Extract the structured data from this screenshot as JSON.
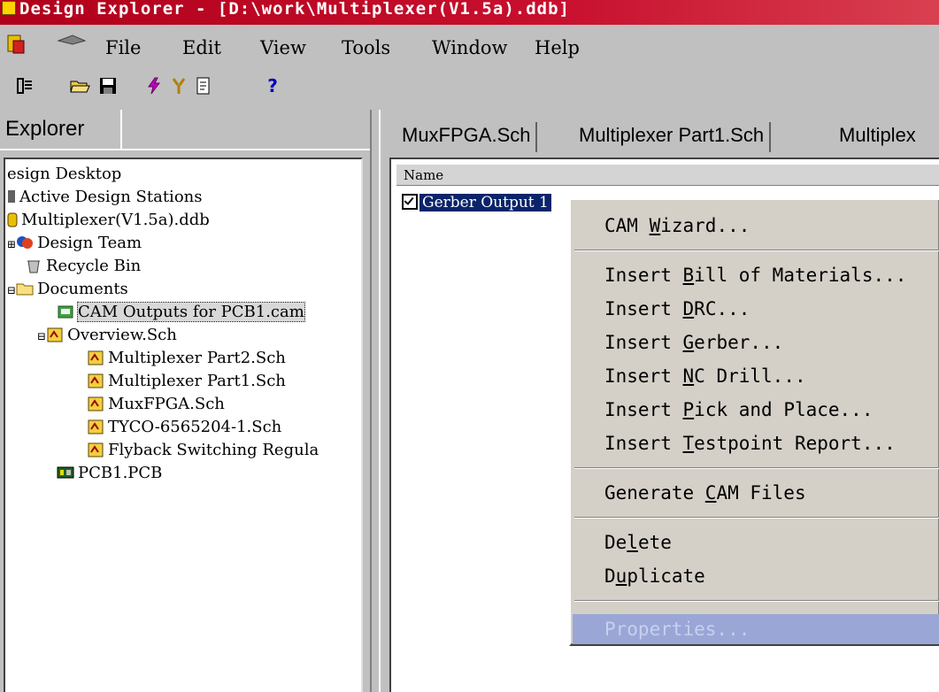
{
  "window": {
    "title": "Design Explorer - [D:\\work\\Multiplexer(V1.5a).ddb]"
  },
  "menu": [
    "File",
    "Edit",
    "View",
    "Tools",
    "Window",
    "Help"
  ],
  "toolbar": {
    "icons": [
      "explorer-toggle-icon",
      "open-folder-icon",
      "save-icon",
      "lightning-icon",
      "tool-icon",
      "document-icon",
      "help-icon"
    ],
    "help_glyph": "?"
  },
  "explorer": {
    "tab_label": "Explorer",
    "tree": [
      {
        "label": "esign Desktop"
      },
      {
        "label": "Active Design Stations"
      },
      {
        "label": "Multiplexer(V1.5a).ddb"
      },
      {
        "label": "Design Team"
      },
      {
        "label": "Recycle Bin"
      },
      {
        "label": "Documents"
      },
      {
        "label": "CAM Outputs for PCB1.cam",
        "selected": true
      },
      {
        "label": "Overview.Sch"
      },
      {
        "label": "Multiplexer Part2.Sch"
      },
      {
        "label": "Multiplexer Part1.Sch"
      },
      {
        "label": "MuxFPGA.Sch"
      },
      {
        "label": "TYCO-6565204-1.Sch"
      },
      {
        "label": "Flyback Switching Regula"
      },
      {
        "label": "PCB1.PCB"
      }
    ]
  },
  "doc_tabs": [
    "MuxFPGA.Sch",
    "Multiplexer Part1.Sch",
    "Multiplex"
  ],
  "list": {
    "column_header": "Name",
    "item": {
      "label": "Gerber Output 1",
      "checked": true
    }
  },
  "context_menu": {
    "items": [
      {
        "pre": "CAM ",
        "acc": "W",
        "post": "izard..."
      },
      {
        "pre": "Insert ",
        "acc": "B",
        "post": "ill of Materials..."
      },
      {
        "pre": "Insert ",
        "acc": "D",
        "post": "RC..."
      },
      {
        "pre": "Insert ",
        "acc": "G",
        "post": "erber..."
      },
      {
        "pre": "Insert ",
        "acc": "N",
        "post": "C Drill..."
      },
      {
        "pre": "Insert ",
        "acc": "P",
        "post": "ick and Place..."
      },
      {
        "pre": "Insert ",
        "acc": "T",
        "post": "estpoint Report..."
      },
      {
        "pre": "Generate ",
        "acc": "C",
        "post": "AM Files"
      },
      {
        "pre": "De",
        "acc": "l",
        "post": "ete"
      },
      {
        "pre": "D",
        "acc": "u",
        "post": "plicate"
      }
    ],
    "highlighted": "Properties...",
    "colors": {
      "highlight": "#9aa6d6",
      "selection": "#0a246a",
      "title": "#c8102e"
    }
  }
}
